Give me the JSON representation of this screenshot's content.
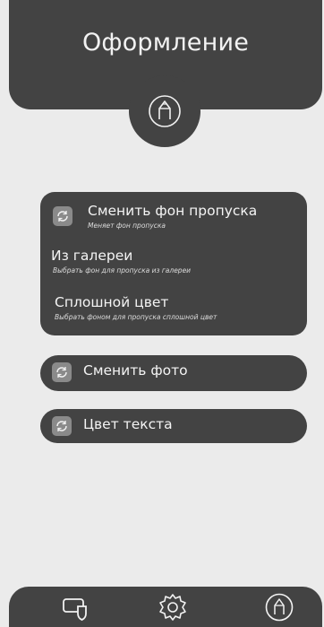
{
  "header": {
    "title": "Оформление"
  },
  "change_background": {
    "title": "Сменить фон пропуска",
    "subtitle": "Меняет фон пропуска",
    "options": [
      {
        "title": "Из галереи",
        "subtitle": "Выбрать фон для пропуска из галереи"
      },
      {
        "title": "Сплошной цвет",
        "subtitle": "Выбрать фоном для пропуска сплошной цвет"
      }
    ]
  },
  "change_photo": {
    "title": "Сменить фото"
  },
  "text_color": {
    "title": "Цвет текста"
  },
  "bottom_nav": {
    "items": [
      "pass-icon",
      "gear-icon",
      "pen-icon"
    ]
  },
  "colors": {
    "dark": "#434343",
    "background": "#ebebeb",
    "accent_button": "#8a8a8a",
    "text": "#f2f2f2"
  }
}
